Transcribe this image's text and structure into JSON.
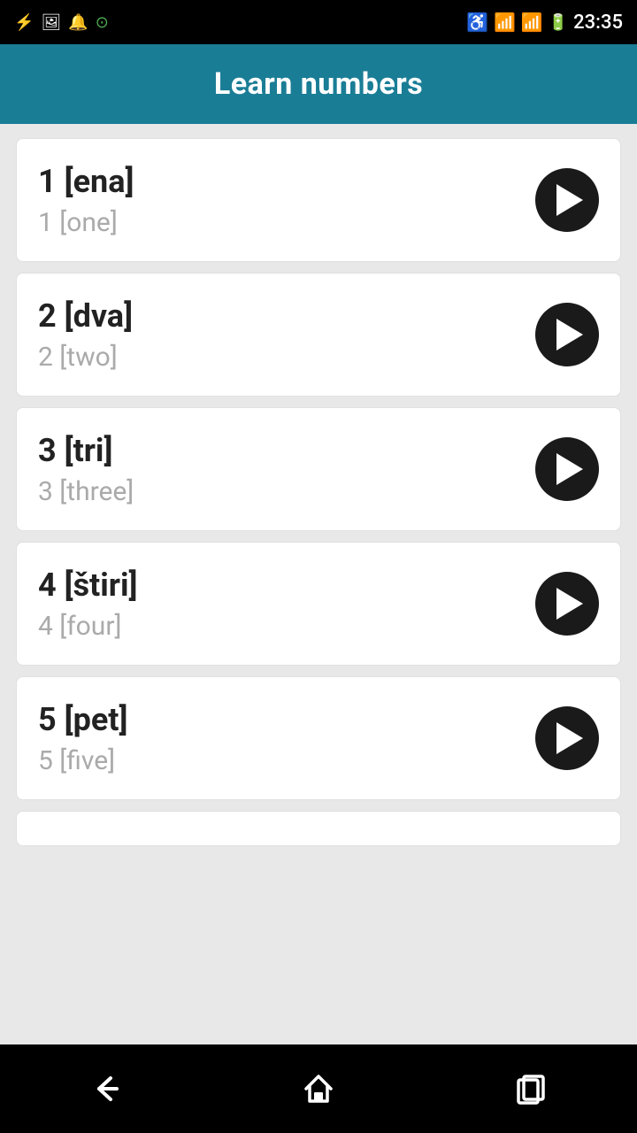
{
  "statusBar": {
    "time": "23:35",
    "icons": [
      "usb",
      "image",
      "audio",
      "battery-ring"
    ]
  },
  "appBar": {
    "title": "Learn numbers"
  },
  "numbers": [
    {
      "id": 1,
      "primary": "1 [ena]",
      "secondary": "1 [one]"
    },
    {
      "id": 2,
      "primary": "2 [dva]",
      "secondary": "2 [two]"
    },
    {
      "id": 3,
      "primary": "3 [tri]",
      "secondary": "3 [three]"
    },
    {
      "id": 4,
      "primary": "4 [štiri]",
      "secondary": "4 [four]"
    },
    {
      "id": 5,
      "primary": "5 [pet]",
      "secondary": "5 [five]"
    }
  ],
  "bottomNav": {
    "back": "back",
    "home": "home",
    "recents": "recents"
  }
}
